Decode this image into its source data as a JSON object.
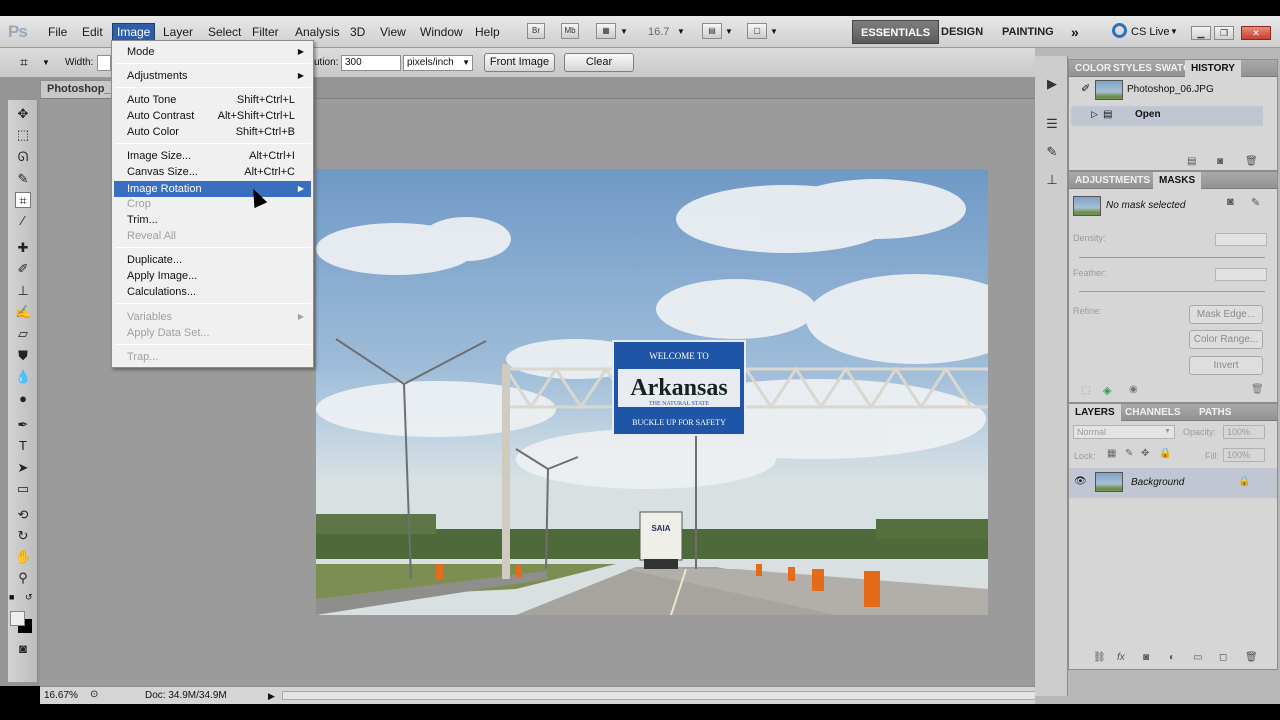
{
  "app": {
    "logo": "Ps"
  },
  "menubar": [
    "File",
    "Edit",
    "Image",
    "Layer",
    "Select",
    "Filter",
    "Analysis",
    "3D",
    "View",
    "Window",
    "Help"
  ],
  "appbar": {
    "br": "Br",
    "mb": "Mb",
    "zoom": "16.7"
  },
  "workspaces": [
    "ESSENTIALS",
    "DESIGN",
    "PAINTING"
  ],
  "cslive": "CS Live",
  "options": {
    "width_label": "Width:",
    "resolution_label": "ution:",
    "resolution_value": "300",
    "units": "pixels/inch",
    "front_image": "Front Image",
    "clear": "Clear"
  },
  "doc_tab": "Photoshop_",
  "status": {
    "zoom": "16.67%",
    "doc": "Doc: 34.9M/34.9M"
  },
  "image_menu": [
    {
      "label": "Mode",
      "submenu": true
    },
    {
      "label": "Adjustments",
      "submenu": true
    },
    {
      "label": "Auto Tone",
      "shortcut": "Shift+Ctrl+L"
    },
    {
      "label": "Auto Contrast",
      "shortcut": "Alt+Shift+Ctrl+L"
    },
    {
      "label": "Auto Color",
      "shortcut": "Shift+Ctrl+B"
    },
    {
      "label": "Image Size...",
      "shortcut": "Alt+Ctrl+I"
    },
    {
      "label": "Canvas Size...",
      "shortcut": "Alt+Ctrl+C"
    },
    {
      "label": "Image Rotation",
      "submenu": true
    },
    {
      "label": "Crop"
    },
    {
      "label": "Trim..."
    },
    {
      "label": "Reveal All"
    },
    {
      "label": "Duplicate..."
    },
    {
      "label": "Apply Image..."
    },
    {
      "label": "Calculations..."
    },
    {
      "label": "Variables",
      "submenu": true
    },
    {
      "label": "Apply Data Set..."
    },
    {
      "label": "Trap..."
    }
  ],
  "panels": {
    "top_tabs": [
      "COLOR",
      "STYLES",
      "SWATC",
      "HISTORY"
    ],
    "history": {
      "snapshot": "Photoshop_06.JPG",
      "state": "Open"
    },
    "mid_tabs": [
      "ADJUSTMENTS",
      "MASKS"
    ],
    "masks": {
      "status": "No mask selected",
      "density": "Density:",
      "feather": "Feather:",
      "refine": "Refine:",
      "mask_edge": "Mask Edge...",
      "color_range": "Color Range...",
      "invert": "Invert"
    },
    "layer_tabs": [
      "LAYERS",
      "CHANNELS",
      "PATHS"
    ],
    "layers": {
      "blend": "Normal",
      "opacity_label": "Opacity:",
      "opacity": "100%",
      "lock_label": "Lock:",
      "fill_label": "Fill:",
      "fill": "100%",
      "layer_name": "Background"
    }
  },
  "sign": {
    "line1": "WELCOME TO",
    "line2": "Arkansas",
    "line3": "THE NATURAL STATE",
    "line4": "BUCKLE UP FOR SAFETY",
    "truck": "SAIA"
  }
}
